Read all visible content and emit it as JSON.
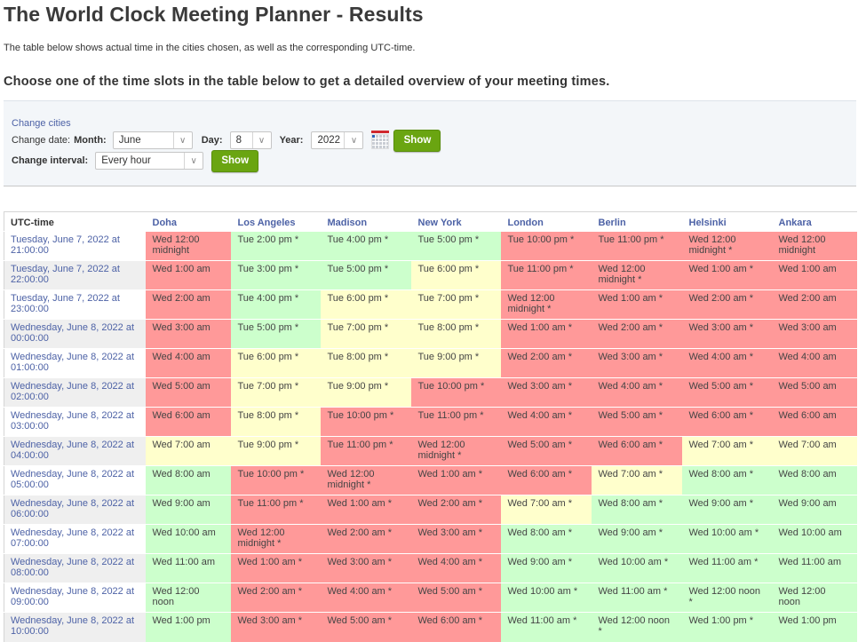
{
  "page": {
    "title": "The World Clock Meeting Planner - Results",
    "intro": "The table below shows actual time in the cities chosen, as well as the corresponding UTC-time.",
    "subtitle": "Choose one of the time slots in the table below to get a detailed overview of your meeting times."
  },
  "controls": {
    "change_cities_link": "Change cities",
    "change_date_label": "Change date:",
    "month_label": "Month:",
    "month_value": "June",
    "day_label": "Day:",
    "day_value": "8",
    "year_label": "Year:",
    "year_value": "2022",
    "calendar_icon": "calendar-icon",
    "show_button_1": "Show",
    "change_interval_label": "Change interval:",
    "interval_value": "Every hour",
    "show_button_2": "Show",
    "dropdown_icon": "chevron-down-icon"
  },
  "colors": {
    "bad": "#ff9999",
    "good": "#ccffcc",
    "ok": "#ffffcc",
    "link": "#4d62a6",
    "button": "#6aa511"
  },
  "table": {
    "headers": [
      "UTC-time",
      "Doha",
      "Los Angeles",
      "Madison",
      "New York",
      "London",
      "Berlin",
      "Helsinki",
      "Ankara"
    ],
    "rows": [
      {
        "utc": "Tuesday, June 7, 2022 at 21:00:00",
        "cells": [
          {
            "t": "Wed 12:00 midnight",
            "s": "r"
          },
          {
            "t": "Tue 2:00 pm *",
            "s": "g"
          },
          {
            "t": "Tue 4:00 pm *",
            "s": "g"
          },
          {
            "t": "Tue 5:00 pm *",
            "s": "g"
          },
          {
            "t": "Tue 10:00 pm *",
            "s": "r"
          },
          {
            "t": "Tue 11:00 pm *",
            "s": "r"
          },
          {
            "t": "Wed 12:00 midnight *",
            "s": "r"
          },
          {
            "t": "Wed 12:00 midnight",
            "s": "r"
          }
        ]
      },
      {
        "utc": "Tuesday, June 7, 2022 at 22:00:00",
        "cells": [
          {
            "t": "Wed 1:00 am",
            "s": "r"
          },
          {
            "t": "Tue 3:00 pm *",
            "s": "g"
          },
          {
            "t": "Tue 5:00 pm *",
            "s": "g"
          },
          {
            "t": "Tue 6:00 pm *",
            "s": "y"
          },
          {
            "t": "Tue 11:00 pm *",
            "s": "r"
          },
          {
            "t": "Wed 12:00 midnight *",
            "s": "r"
          },
          {
            "t": "Wed 1:00 am *",
            "s": "r"
          },
          {
            "t": "Wed 1:00 am",
            "s": "r"
          }
        ]
      },
      {
        "utc": "Tuesday, June 7, 2022 at 23:00:00",
        "cells": [
          {
            "t": "Wed 2:00 am",
            "s": "r"
          },
          {
            "t": "Tue 4:00 pm *",
            "s": "g"
          },
          {
            "t": "Tue 6:00 pm *",
            "s": "y"
          },
          {
            "t": "Tue 7:00 pm *",
            "s": "y"
          },
          {
            "t": "Wed 12:00 midnight *",
            "s": "r"
          },
          {
            "t": "Wed 1:00 am *",
            "s": "r"
          },
          {
            "t": "Wed 2:00 am *",
            "s": "r"
          },
          {
            "t": "Wed 2:00 am",
            "s": "r"
          }
        ]
      },
      {
        "utc": "Wednesday, June 8, 2022 at 00:00:00",
        "cells": [
          {
            "t": "Wed 3:00 am",
            "s": "r"
          },
          {
            "t": "Tue 5:00 pm *",
            "s": "g"
          },
          {
            "t": "Tue 7:00 pm *",
            "s": "y"
          },
          {
            "t": "Tue 8:00 pm *",
            "s": "y"
          },
          {
            "t": "Wed 1:00 am *",
            "s": "r"
          },
          {
            "t": "Wed 2:00 am *",
            "s": "r"
          },
          {
            "t": "Wed 3:00 am *",
            "s": "r"
          },
          {
            "t": "Wed 3:00 am",
            "s": "r"
          }
        ]
      },
      {
        "utc": "Wednesday, June 8, 2022 at 01:00:00",
        "cells": [
          {
            "t": "Wed 4:00 am",
            "s": "r"
          },
          {
            "t": "Tue 6:00 pm *",
            "s": "y"
          },
          {
            "t": "Tue 8:00 pm *",
            "s": "y"
          },
          {
            "t": "Tue 9:00 pm *",
            "s": "y"
          },
          {
            "t": "Wed 2:00 am *",
            "s": "r"
          },
          {
            "t": "Wed 3:00 am *",
            "s": "r"
          },
          {
            "t": "Wed 4:00 am *",
            "s": "r"
          },
          {
            "t": "Wed 4:00 am",
            "s": "r"
          }
        ]
      },
      {
        "utc": "Wednesday, June 8, 2022 at 02:00:00",
        "cells": [
          {
            "t": "Wed 5:00 am",
            "s": "r"
          },
          {
            "t": "Tue 7:00 pm *",
            "s": "y"
          },
          {
            "t": "Tue 9:00 pm *",
            "s": "y"
          },
          {
            "t": "Tue 10:00 pm *",
            "s": "r"
          },
          {
            "t": "Wed 3:00 am *",
            "s": "r"
          },
          {
            "t": "Wed 4:00 am *",
            "s": "r"
          },
          {
            "t": "Wed 5:00 am *",
            "s": "r"
          },
          {
            "t": "Wed 5:00 am",
            "s": "r"
          }
        ]
      },
      {
        "utc": "Wednesday, June 8, 2022 at 03:00:00",
        "cells": [
          {
            "t": "Wed 6:00 am",
            "s": "r"
          },
          {
            "t": "Tue 8:00 pm *",
            "s": "y"
          },
          {
            "t": "Tue 10:00 pm *",
            "s": "r"
          },
          {
            "t": "Tue 11:00 pm *",
            "s": "r"
          },
          {
            "t": "Wed 4:00 am *",
            "s": "r"
          },
          {
            "t": "Wed 5:00 am *",
            "s": "r"
          },
          {
            "t": "Wed 6:00 am *",
            "s": "r"
          },
          {
            "t": "Wed 6:00 am",
            "s": "r"
          }
        ]
      },
      {
        "utc": "Wednesday, June 8, 2022 at 04:00:00",
        "cells": [
          {
            "t": "Wed 7:00 am",
            "s": "y"
          },
          {
            "t": "Tue 9:00 pm *",
            "s": "y"
          },
          {
            "t": "Tue 11:00 pm *",
            "s": "r"
          },
          {
            "t": "Wed 12:00 midnight *",
            "s": "r"
          },
          {
            "t": "Wed 5:00 am *",
            "s": "r"
          },
          {
            "t": "Wed 6:00 am *",
            "s": "r"
          },
          {
            "t": "Wed 7:00 am *",
            "s": "y"
          },
          {
            "t": "Wed 7:00 am",
            "s": "y"
          }
        ]
      },
      {
        "utc": "Wednesday, June 8, 2022 at 05:00:00",
        "cells": [
          {
            "t": "Wed 8:00 am",
            "s": "g"
          },
          {
            "t": "Tue 10:00 pm *",
            "s": "r"
          },
          {
            "t": "Wed 12:00 midnight *",
            "s": "r"
          },
          {
            "t": "Wed 1:00 am *",
            "s": "r"
          },
          {
            "t": "Wed 6:00 am *",
            "s": "r"
          },
          {
            "t": "Wed 7:00 am *",
            "s": "y"
          },
          {
            "t": "Wed 8:00 am *",
            "s": "g"
          },
          {
            "t": "Wed 8:00 am",
            "s": "g"
          }
        ]
      },
      {
        "utc": "Wednesday, June 8, 2022 at 06:00:00",
        "cells": [
          {
            "t": "Wed 9:00 am",
            "s": "g"
          },
          {
            "t": "Tue 11:00 pm *",
            "s": "r"
          },
          {
            "t": "Wed 1:00 am *",
            "s": "r"
          },
          {
            "t": "Wed 2:00 am *",
            "s": "r"
          },
          {
            "t": "Wed 7:00 am *",
            "s": "y"
          },
          {
            "t": "Wed 8:00 am *",
            "s": "g"
          },
          {
            "t": "Wed 9:00 am *",
            "s": "g"
          },
          {
            "t": "Wed 9:00 am",
            "s": "g"
          }
        ]
      },
      {
        "utc": "Wednesday, June 8, 2022 at 07:00:00",
        "cells": [
          {
            "t": "Wed 10:00 am",
            "s": "g"
          },
          {
            "t": "Wed 12:00 midnight *",
            "s": "r"
          },
          {
            "t": "Wed 2:00 am *",
            "s": "r"
          },
          {
            "t": "Wed 3:00 am *",
            "s": "r"
          },
          {
            "t": "Wed 8:00 am *",
            "s": "g"
          },
          {
            "t": "Wed 9:00 am *",
            "s": "g"
          },
          {
            "t": "Wed 10:00 am *",
            "s": "g"
          },
          {
            "t": "Wed 10:00 am",
            "s": "g"
          }
        ]
      },
      {
        "utc": "Wednesday, June 8, 2022 at 08:00:00",
        "cells": [
          {
            "t": "Wed 11:00 am",
            "s": "g"
          },
          {
            "t": "Wed 1:00 am *",
            "s": "r"
          },
          {
            "t": "Wed 3:00 am *",
            "s": "r"
          },
          {
            "t": "Wed 4:00 am *",
            "s": "r"
          },
          {
            "t": "Wed 9:00 am *",
            "s": "g"
          },
          {
            "t": "Wed 10:00 am *",
            "s": "g"
          },
          {
            "t": "Wed 11:00 am *",
            "s": "g"
          },
          {
            "t": "Wed 11:00 am",
            "s": "g"
          }
        ]
      },
      {
        "utc": "Wednesday, June 8, 2022 at 09:00:00",
        "cells": [
          {
            "t": "Wed 12:00 noon",
            "s": "g"
          },
          {
            "t": "Wed 2:00 am *",
            "s": "r"
          },
          {
            "t": "Wed 4:00 am *",
            "s": "r"
          },
          {
            "t": "Wed 5:00 am *",
            "s": "r"
          },
          {
            "t": "Wed 10:00 am *",
            "s": "g"
          },
          {
            "t": "Wed 11:00 am *",
            "s": "g"
          },
          {
            "t": "Wed 12:00 noon *",
            "s": "g"
          },
          {
            "t": "Wed 12:00 noon",
            "s": "g"
          }
        ]
      },
      {
        "utc": "Wednesday, June 8, 2022 at 10:00:00",
        "cells": [
          {
            "t": "Wed 1:00 pm",
            "s": "g"
          },
          {
            "t": "Wed 3:00 am *",
            "s": "r"
          },
          {
            "t": "Wed 5:00 am *",
            "s": "r"
          },
          {
            "t": "Wed 6:00 am *",
            "s": "r"
          },
          {
            "t": "Wed 11:00 am *",
            "s": "g"
          },
          {
            "t": "Wed 12:00 noon *",
            "s": "g"
          },
          {
            "t": "Wed 1:00 pm *",
            "s": "g"
          },
          {
            "t": "Wed 1:00 pm",
            "s": "g"
          }
        ]
      }
    ]
  }
}
